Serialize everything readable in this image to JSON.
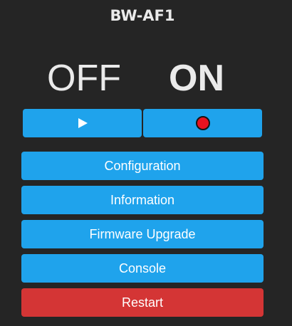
{
  "device": {
    "title": "BW-AF1"
  },
  "power": {
    "off_label": "OFF",
    "on_label": "ON"
  },
  "controls": {
    "play_icon": "play-icon",
    "record_icon": "record-icon",
    "record_color": "#e8131f"
  },
  "menu": {
    "configuration": "Configuration",
    "information": "Information",
    "firmware_upgrade": "Firmware Upgrade",
    "console": "Console",
    "restart": "Restart"
  },
  "colors": {
    "background": "#252525",
    "button_primary": "#1fa3ec",
    "button_danger": "#d43535",
    "text": "#eaeaea"
  }
}
